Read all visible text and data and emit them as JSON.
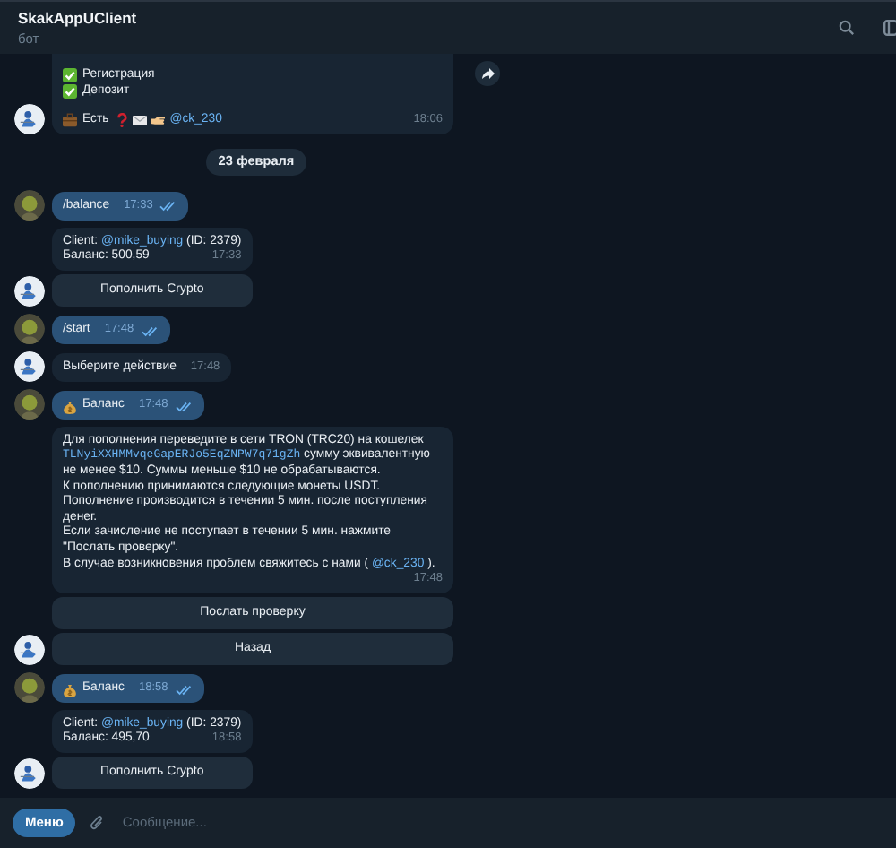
{
  "header": {
    "title": "SkakAppUClient",
    "subtitle": "бот"
  },
  "messages": [
    {
      "kind": "bot",
      "forward": true,
      "lines": [
        {
          "parts": [
            {
              "kind": "check"
            },
            {
              "kind": "text",
              "text": "Регистрация"
            }
          ]
        },
        {
          "parts": [
            {
              "kind": "check"
            },
            {
              "kind": "text",
              "text": "Депозит"
            }
          ]
        },
        {
          "parts": [
            {
              "kind": "briefcase"
            },
            {
              "kind": "text",
              "text": "Есть"
            },
            {
              "kind": "question"
            },
            {
              "kind": "envelope"
            },
            {
              "kind": "hand"
            },
            {
              "kind": "link",
              "text": "@ck_230"
            }
          ]
        }
      ],
      "time": "18:06"
    },
    {
      "kind": "date",
      "text": "23 февраля"
    },
    {
      "kind": "user",
      "read": true,
      "lines": [
        {
          "parts": [
            {
              "kind": "text",
              "text": "/balance"
            }
          ]
        }
      ],
      "time": "17:33"
    },
    {
      "kind": "bot",
      "lines": [
        {
          "parts": [
            {
              "kind": "text",
              "text": "Client: "
            },
            {
              "kind": "link",
              "text": "@mike_buying"
            },
            {
              "kind": "text",
              "text": " (ID: 2379)"
            }
          ]
        },
        {
          "parts": [
            {
              "kind": "text",
              "text": "Баланс: 500,59"
            }
          ]
        }
      ],
      "time": "17:33",
      "buttons": [
        "Пополнить Crypto"
      ]
    },
    {
      "kind": "user",
      "read": true,
      "lines": [
        {
          "parts": [
            {
              "kind": "text",
              "text": "/start"
            }
          ]
        }
      ],
      "time": "17:48"
    },
    {
      "kind": "bot",
      "lines": [
        {
          "parts": [
            {
              "kind": "text",
              "text": "Выберите действие"
            }
          ]
        }
      ],
      "time": "17:48"
    },
    {
      "kind": "user",
      "read": true,
      "lines": [
        {
          "parts": [
            {
              "kind": "moneybag"
            },
            {
              "kind": "text",
              "text": "Баланс"
            }
          ]
        }
      ],
      "time": "17:48"
    },
    {
      "kind": "bot",
      "lines": [
        {
          "parts": [
            {
              "kind": "text",
              "text": "Для пополнения переведите в сети TRON (TRC20) на кошелек"
            }
          ]
        },
        {
          "parts": [
            {
              "kind": "code_link",
              "text": "TLNyiXXHMMvqeGapERJo5EqZNPW7q71gZh"
            },
            {
              "kind": "text",
              "text": " сумму эквивалентную"
            }
          ]
        },
        {
          "parts": [
            {
              "kind": "text",
              "text": "не менее $10. Суммы меньше $10 не обрабатываются."
            }
          ]
        },
        {
          "parts": [
            {
              "kind": "text",
              "text": "К пополнению принимаются следующие монеты USDT."
            }
          ]
        },
        {
          "parts": [
            {
              "kind": "text",
              "text": "Пополнение производится в течении 5 мин. после поступления"
            }
          ]
        },
        {
          "parts": [
            {
              "kind": "text",
              "text": "денег."
            }
          ]
        },
        {
          "parts": [
            {
              "kind": "text",
              "text": "Если зачисление не поступает в течении 5 мин. нажмите"
            }
          ]
        },
        {
          "parts": [
            {
              "kind": "text",
              "text": "\"Послать проверку\"."
            }
          ]
        },
        {
          "parts": [
            {
              "kind": "text",
              "text": "В случае возникновения проблем свяжитесь с нами ( "
            },
            {
              "kind": "link",
              "text": "@ck_230"
            },
            {
              "kind": "text",
              "text": " )."
            }
          ]
        }
      ],
      "time": "17:48",
      "buttons": [
        "Послать проверку",
        "Назад"
      ]
    },
    {
      "kind": "user",
      "read": true,
      "lines": [
        {
          "parts": [
            {
              "kind": "moneybag"
            },
            {
              "kind": "text",
              "text": "Баланс"
            }
          ]
        }
      ],
      "time": "18:58"
    },
    {
      "kind": "bot",
      "lines": [
        {
          "parts": [
            {
              "kind": "text",
              "text": "Client: "
            },
            {
              "kind": "link",
              "text": "@mike_buying"
            },
            {
              "kind": "text",
              "text": " (ID: 2379)"
            }
          ]
        },
        {
          "parts": [
            {
              "kind": "text",
              "text": "Баланс: 495,70"
            }
          ]
        }
      ],
      "time": "18:58",
      "buttons": [
        "Пополнить Crypto"
      ]
    }
  ],
  "composer": {
    "menu_button": "Меню",
    "placeholder": "Сообщение..."
  }
}
